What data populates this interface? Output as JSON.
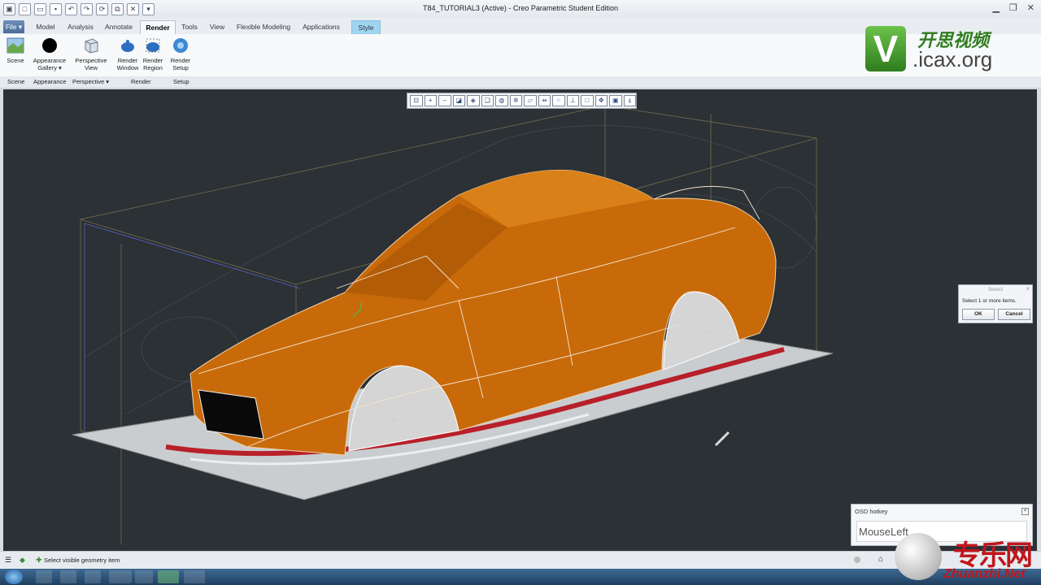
{
  "window": {
    "title": "T84_TUTORIAL3 (Active) - Creo Parametric Student Edition",
    "qat_icons": [
      "app-icon",
      "new-icon",
      "open-icon",
      "save-icon",
      "undo-icon",
      "redo-icon",
      "regenerate-icon",
      "windows-icon",
      "close-window-icon",
      "more-icon"
    ]
  },
  "tabs": [
    "File",
    "Model",
    "Analysis",
    "Annotate",
    "Render",
    "Tools",
    "View",
    "Flexible Modeling",
    "Applications",
    "Style"
  ],
  "active_tab": "Render",
  "ribbon": {
    "buttons": [
      {
        "label1": "Scene",
        "label2": ""
      },
      {
        "label1": "Appearance",
        "label2": "Gallery ▾"
      },
      {
        "label1": "Perspective",
        "label2": "View"
      },
      {
        "label1": "Render",
        "label2": "Window"
      },
      {
        "label1": "Render",
        "label2": "Region"
      },
      {
        "label1": "Render",
        "label2": "Setup"
      }
    ],
    "groups": [
      "Scene",
      "Appearance",
      "Perspective ▾",
      "Render",
      "Setup"
    ]
  },
  "logo": {
    "brand_text": "开思视频",
    "url_text": ".icax.org",
    "letter": "V"
  },
  "view_toolbar": {
    "icons": [
      "refit-icon",
      "zoom-in-icon",
      "zoom-out-icon",
      "repaint-icon",
      "orient-icon",
      "saved-views-icon",
      "display-style-icon",
      "view-manager-icon",
      "datum-planes-icon",
      "datum-axes-icon",
      "datum-points-icon",
      "csys-icon",
      "annotations-icon",
      "spin-center-icon",
      "snapshot-icon",
      "more-view-icon"
    ]
  },
  "select_dialog": {
    "title": "Select",
    "message": "Select 1 or more items.",
    "ok": "OK",
    "cancel": "Cancel"
  },
  "osd": {
    "header": "OSD hotkey",
    "key": "MouseLeft"
  },
  "status": {
    "message": "Select visible geometry item"
  },
  "watermark": {
    "cn": "专乐网",
    "en": "Zhuanzhi.Net"
  },
  "colors": {
    "car_body": "#c86a0a",
    "viewport_bg": "#2b3135",
    "accent_tab": "#9fd5ee"
  }
}
